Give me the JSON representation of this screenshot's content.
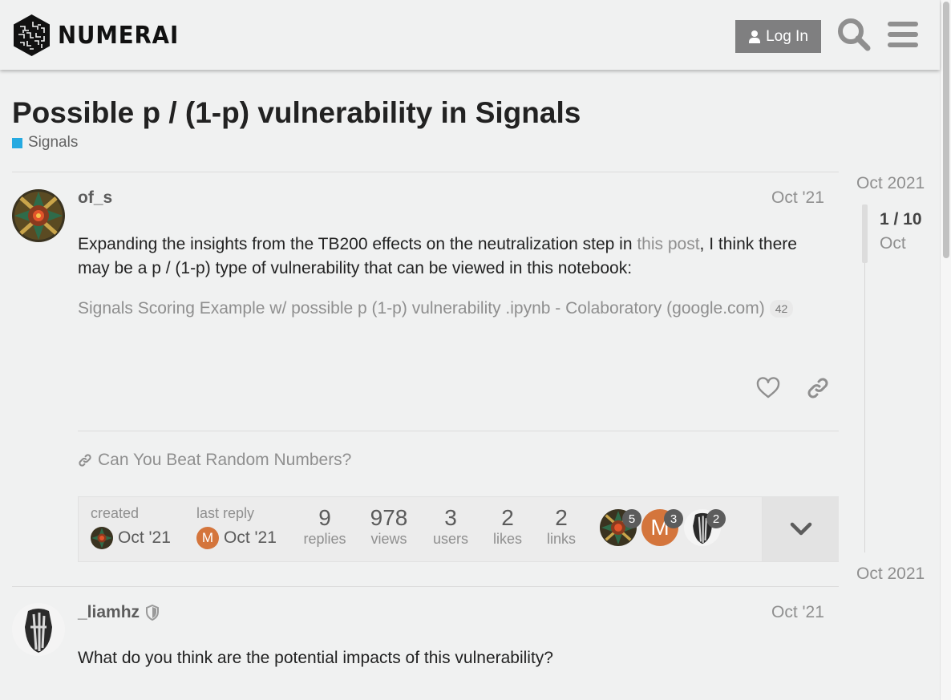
{
  "header": {
    "logo_text": "NUMERAI",
    "login_label": "Log In",
    "icons": [
      "user-icon",
      "search-icon",
      "hamburger-menu-icon"
    ]
  },
  "topic": {
    "title": "Possible p / (1-p) vulnerability in Signals",
    "category": "Signals",
    "category_color": "#25aae1"
  },
  "posts": [
    {
      "username": "of_s",
      "date": "Oct '21",
      "text_before": "Expanding the insights from the TB200 effects on the neutralization step in ",
      "link_text": "this post",
      "text_after": ", I think there may be a p / (1-p) type of vulnerability that can be viewed in this notebook:",
      "onebox_text": "Signals Scoring Example w/ possible p (1-p) vulnerability .ipynb - Colaboratory (google.com)",
      "onebox_clicks": "42",
      "icons": [
        "heart-icon",
        "link-icon"
      ]
    },
    {
      "username": "_liamhz",
      "date": "Oct '21",
      "text": "What do you think are the potential impacts of this vulnerability?"
    }
  ],
  "linked_topic": "Can You Beat Random Numbers?",
  "topic_map": {
    "created_label": "created",
    "created_date": "Oct '21",
    "last_reply_label": "last reply",
    "last_reply_date": "Oct '21",
    "last_reply_initial": "M",
    "stats": [
      {
        "value": "9",
        "label": "replies"
      },
      {
        "value": "978",
        "label": "views"
      },
      {
        "value": "3",
        "label": "users"
      },
      {
        "value": "2",
        "label": "likes"
      },
      {
        "value": "2",
        "label": "links"
      }
    ],
    "participants": [
      {
        "count": "5"
      },
      {
        "initial": "M",
        "count": "3"
      },
      {
        "count": "2"
      }
    ]
  },
  "timeline": {
    "top_date": "Oct 2021",
    "position": "1 / 10",
    "sub_date": "Oct",
    "bottom_date": "Oct 2021"
  },
  "colors": {
    "background": "#f0f1f1",
    "login_button": "#7f7f80",
    "avatar_m": "#d4753c"
  }
}
